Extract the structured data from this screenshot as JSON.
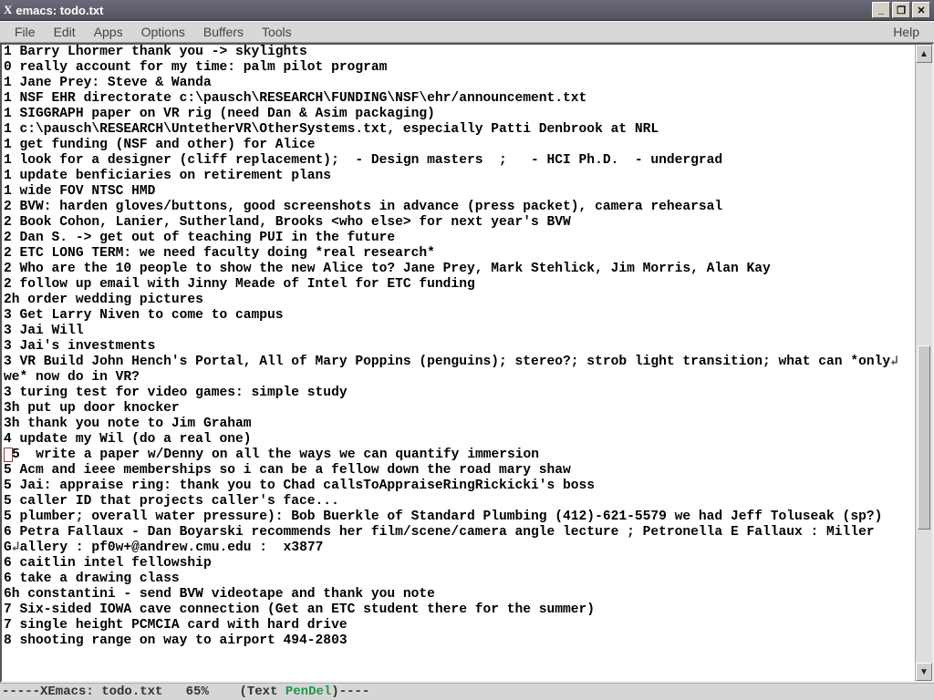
{
  "window": {
    "app_mark": "X",
    "title": "emacs: todo.txt"
  },
  "menus": {
    "file": "File",
    "edit": "Edit",
    "apps": "Apps",
    "options": "Options",
    "buffers": "Buffers",
    "tools": "Tools",
    "help": "Help"
  },
  "winctl": {
    "min": "_",
    "max": "❐",
    "close": "✕"
  },
  "modeline": {
    "prefix": "-----XEmacs: ",
    "buffer": "todo.txt",
    "percent": "   65%",
    "mode_open": "    (Text ",
    "minor": "PenDel",
    "mode_close": ")----"
  },
  "lines": [
    "1 Barry Lhormer thank you -> skylights",
    "0 really account for my time: palm pilot program",
    "1 Jane Prey: Steve & Wanda",
    "1 NSF EHR directorate c:\\pausch\\RESEARCH\\FUNDING\\NSF\\ehr/announcement.txt",
    "1 SIGGRAPH paper on VR rig (need Dan & Asim packaging)",
    "1 c:\\pausch\\RESEARCH\\UntetherVR\\OtherSystems.txt, especially Patti Denbrook at NRL",
    "1 get funding (NSF and other) for Alice",
    "1 look for a designer (cliff replacement);  - Design masters  ;   - HCI Ph.D.  - undergrad",
    "1 update benficiaries on retirement plans",
    "1 wide FOV NTSC HMD",
    "2 BVW: harden gloves/buttons, good screenshots in advance (press packet), camera rehearsal",
    "2 Book Cohon, Lanier, Sutherland, Brooks <who else> for next year's BVW",
    "2 Dan S. -> get out of teaching PUI in the future",
    "2 ETC LONG TERM: we need faculty doing *real research*",
    "2 Who are the 10 people to show the new Alice to? Jane Prey, Mark Stehlick, Jim Morris, Alan Kay",
    "2 follow up email with Jinny Meade of Intel for ETC funding",
    "2h order wedding pictures",
    "3 Get Larry Niven to come to campus",
    "3 Jai Will",
    "3 Jai's investments",
    "3 VR Build John Hench's Portal, All of Mary Poppins (penguins); stereo?; strob light transition; what can *only↵ we* now do in VR?",
    "3 turing test for video games: simple study",
    "3h put up door knocker",
    "3h thank you note to Jim Graham",
    "4 update my Wil (do a real one)",
    "▯  write a paper w/Denny on all the ways we can quantify immersion",
    "5 Acm and ieee memberships so i can be a fellow down the road mary shaw",
    "5 Jai: appraise ring: thank you to Chad callsToAppraiseRingRickicki's boss",
    "5 caller ID that projects caller's face...",
    "5 plumber; overall water pressure): Bob Buerkle of Standard Plumbing (412)-621-5579 we had Jeff Toluseak (sp?)",
    "6 Petra Fallaux - Dan Boyarski recommends her film/scene/camera angle lecture ; Petronella E Fallaux : Miller G↵allery : pf0w+@andrew.cmu.edu :  x3877",
    "6 caitlin intel fellowship",
    "6 take a drawing class",
    "6h constantini - send BVW videotape and thank you note",
    "7 Six-sided IOWA cave connection (Get an ETC student there for the summer)",
    "7 single height PCMCIA card with hard drive",
    "8 shooting range on way to airport 494-2803"
  ]
}
